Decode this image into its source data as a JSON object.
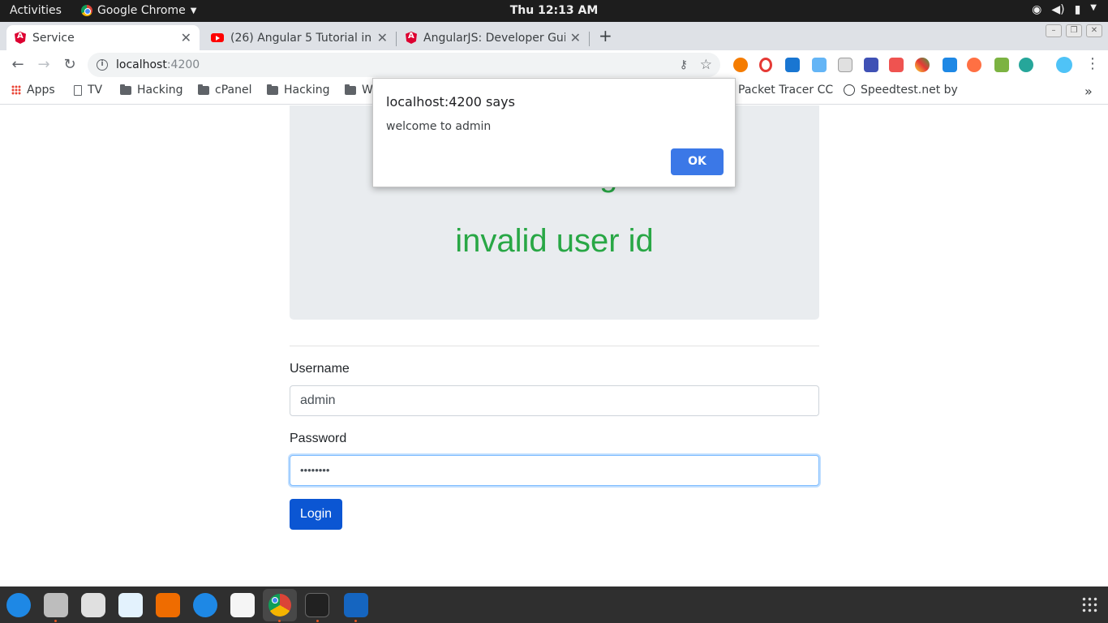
{
  "system_bar": {
    "activities": "Activities",
    "app_name": "Google Chrome",
    "clock": "Thu 12:13 AM"
  },
  "tabs": [
    {
      "title": "Service",
      "active": true,
      "icon": "angular-icon"
    },
    {
      "title": "(26) Angular 5 Tutorial in I",
      "active": false,
      "icon": "youtube-icon"
    },
    {
      "title": "AngularJS: Developer Gui",
      "active": false,
      "icon": "angular-icon"
    }
  ],
  "toolbar": {
    "url_host": "localhost",
    "url_port": ":4200"
  },
  "bookmarks": [
    {
      "label": "Apps",
      "icon": "apps-grid-icon"
    },
    {
      "label": "TV",
      "icon": "page-icon"
    },
    {
      "label": "Hacking",
      "icon": "folder-icon"
    },
    {
      "label": "cPanel",
      "icon": "folder-icon"
    },
    {
      "label": "Hacking",
      "icon": "folder-icon"
    },
    {
      "label": "W",
      "icon": "folder-icon"
    },
    {
      "label": "Packet Tracer CC",
      "icon": "none"
    },
    {
      "label": "Speedtest.net by",
      "icon": "gauge-icon"
    }
  ],
  "page": {
    "jumbotron_title": "Service in Angular 5",
    "jumbotron_message": "invalid user id",
    "username_label": "Username",
    "username_value": "admin",
    "password_label": "Password",
    "password_value": "••••••••",
    "login_button": "Login"
  },
  "dialog": {
    "title": "localhost:4200 says",
    "message": "welcome to admin",
    "ok_button": "OK"
  },
  "colors": {
    "accent_green": "#28a745",
    "button_blue": "#0b56d3",
    "dialog_ok": "#3b78e7"
  }
}
